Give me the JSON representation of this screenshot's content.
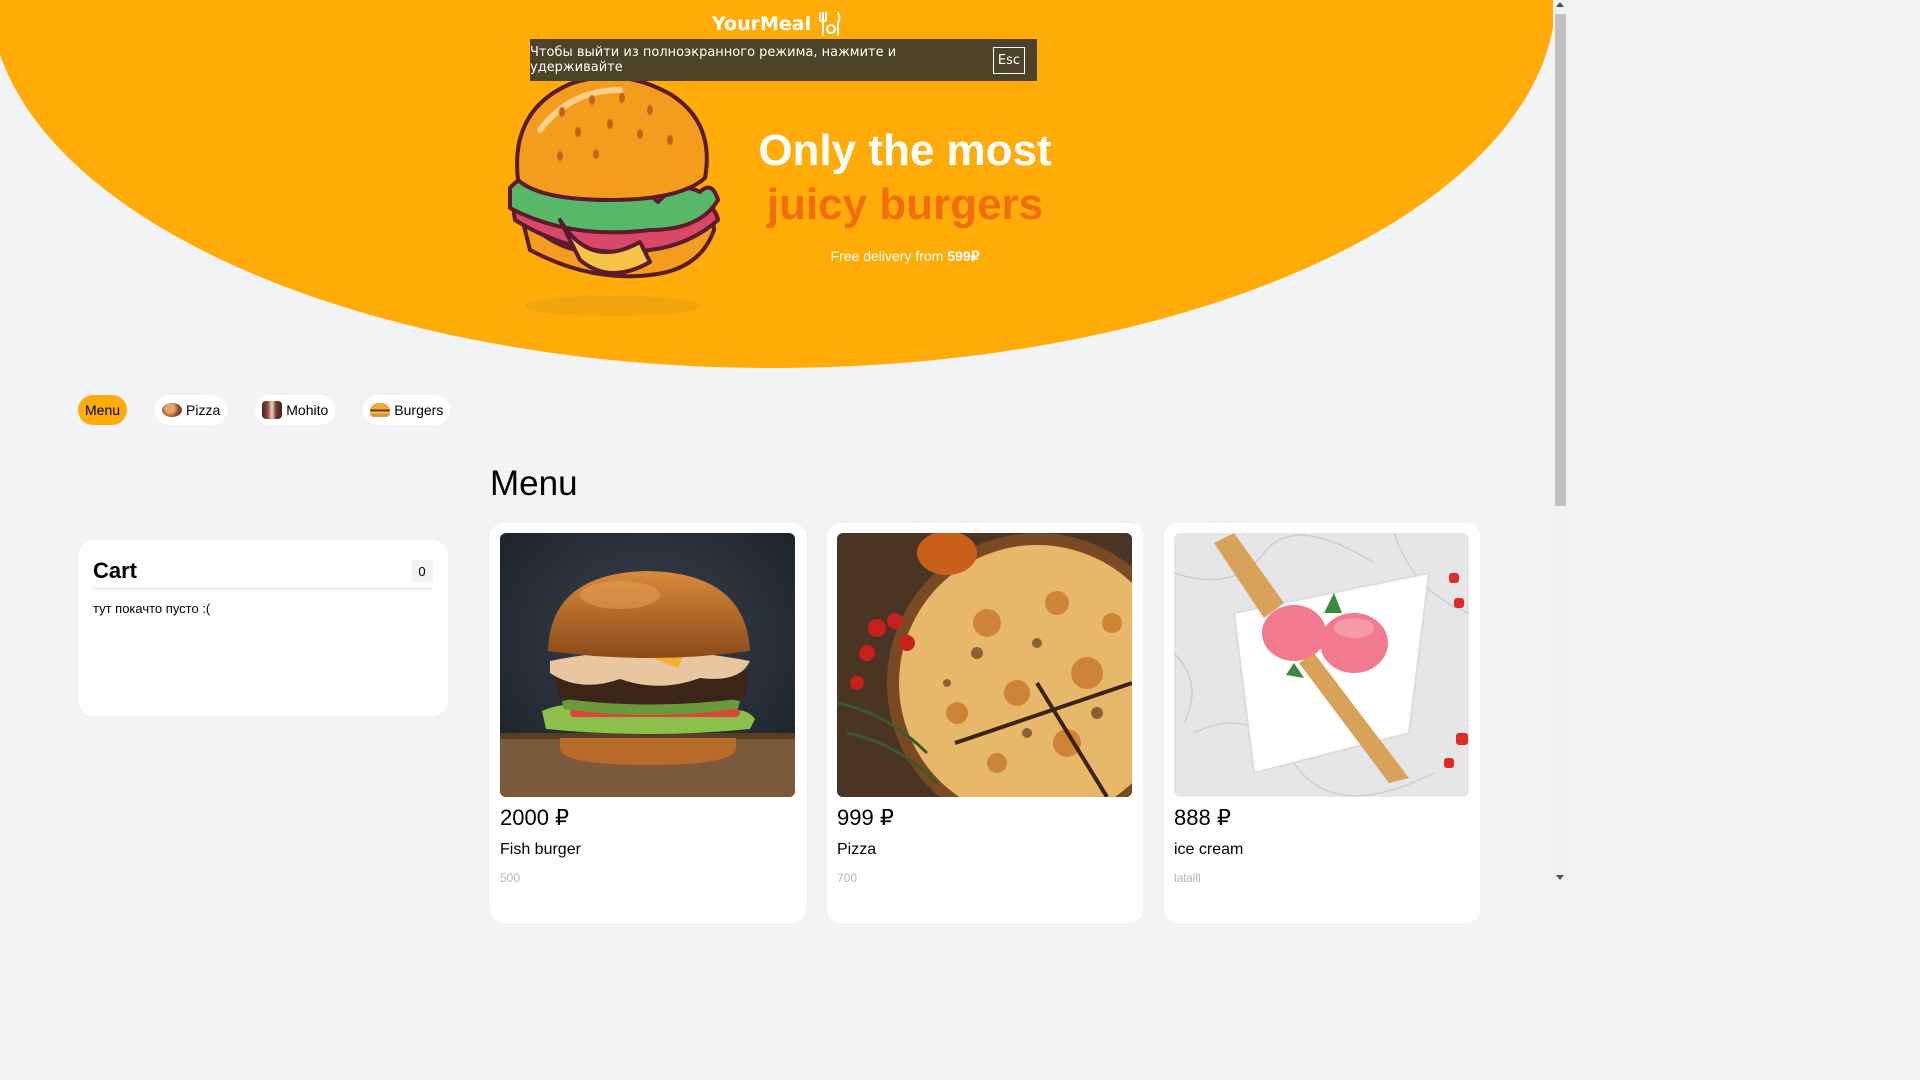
{
  "header": {
    "logo_text": "YourMeal",
    "logo_icon": "fork-knife-icon"
  },
  "fullscreen_toast": {
    "message": "Чтобы выйти из полноэкранного режима, нажмите и удерживайте",
    "key": "Esc"
  },
  "hero": {
    "title_line1": "Only the most",
    "title_line2": "juicy burgers",
    "delivery_text": "Free delivery from ",
    "delivery_price": "599₽"
  },
  "nav": {
    "items": [
      {
        "label": "Menu",
        "icon": "",
        "active": true
      },
      {
        "label": "Pizza",
        "icon": "pizza-icon",
        "active": false
      },
      {
        "label": "Mohito",
        "icon": "mohito-icon",
        "active": false
      },
      {
        "label": "Burgers",
        "icon": "burger-icon",
        "active": false
      }
    ]
  },
  "cart": {
    "title": "Cart",
    "count": "0",
    "empty_text": "тут покачто пусто :("
  },
  "menu": {
    "title": "Menu",
    "products": [
      {
        "price": "2000 ₽",
        "name": "Fish burger",
        "weight": "500"
      },
      {
        "price": "999 ₽",
        "name": "Pizza",
        "weight": "700"
      },
      {
        "price": "888 ₽",
        "name": "ice cream",
        "weight": "lalalll"
      }
    ]
  },
  "colors": {
    "accent": "#ffab08",
    "accent_dark": "#f06e0f",
    "background": "#f2f3f5",
    "toast": "#4d4329"
  }
}
